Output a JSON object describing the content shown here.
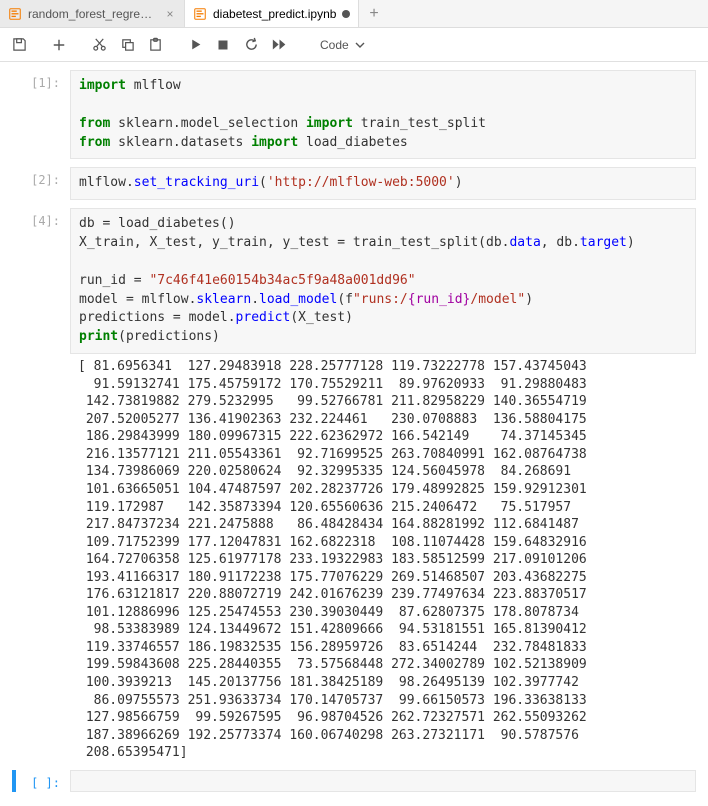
{
  "tabs": [
    {
      "label": "random_forest_regressor_s",
      "active": false,
      "dirty": false
    },
    {
      "label": "diabetest_predict.ipynb",
      "active": true,
      "dirty": true
    }
  ],
  "toolbar": {
    "celltype_label": "Code",
    "icons": {
      "save": "save-icon",
      "add": "plus-icon",
      "cut": "scissors-icon",
      "copy": "copy-icon",
      "paste": "clipboard-icon",
      "run": "play-icon",
      "stop": "stop-icon",
      "restart": "refresh-icon",
      "ff": "fast-forward-icon",
      "dropdown": "chevron-down-icon"
    }
  },
  "cells": [
    {
      "prompt": "[1]:",
      "code_html": "<span class=\"cm-k\">import</span> mlflow\n\n<span class=\"cm-k\">from</span> sklearn.model_selection <span class=\"cm-k\">import</span> train_test_split\n<span class=\"cm-k\">from</span> sklearn.datasets <span class=\"cm-k\">import</span> load_diabetes"
    },
    {
      "prompt": "[2]:",
      "code_html": "mlflow.<span class=\"cm-f\">set_tracking_uri</span>(<span class=\"cm-s\">'http://mlflow-web:5000'</span>)"
    },
    {
      "prompt": "[4]:",
      "code_html": "db = load_diabetes()\nX_train, X_test, y_train, y_test = train_test_split(db.<span class=\"cm-f\">data</span>, db.<span class=\"cm-f\">target</span>)\n\nrun_id = <span class=\"cm-s\">\"7c46f41e60154b34ac5f9a48a001dd96\"</span>\nmodel = mlflow.<span class=\"cm-f\">sklearn</span>.<span class=\"cm-f\">load_model</span>(f<span class=\"cm-rs\">\"runs:/</span><span class=\"cm-ri\">{run_id}</span><span class=\"cm-rs\">/model\"</span>)\npredictions = model.<span class=\"cm-f\">predict</span>(X_test)\n<span class=\"cm-k\">print</span>(predictions)",
      "output": "[ 81.6956341  127.29483918 228.25777128 119.73222778 157.43745043\n  91.59132741 175.45759172 170.75529211  89.97620933  91.29880483\n 142.73819882 279.5232995   99.52766781 211.82958229 140.36554719\n 207.52005277 136.41902363 232.224461   230.0708883  136.58804175\n 186.29843999 180.09967315 222.62362972 166.542149    74.37145345\n 216.13577121 211.05543361  92.71699525 263.70840991 162.08764738\n 134.73986069 220.02580624  92.32995335 124.56045978  84.268691\n 101.63665051 104.47487597 202.28237726 179.48992825 159.92912301\n 119.172987   142.35873394 120.65560636 215.2406472   75.517957\n 217.84737234 221.2475888   86.48428434 164.88281992 112.6841487\n 109.71752399 177.12047831 162.6822318  108.11074428 159.64832916\n 164.72706358 125.61977178 233.19322983 183.58512599 217.09101206\n 193.41166317 180.91172238 175.77076229 269.51468507 203.43682275\n 176.63121817 220.88072719 242.01676239 239.77497634 223.88370517\n 101.12886996 125.25474553 230.39030449  87.62807375 178.8078734\n  98.53383989 124.13449672 151.42809666  94.53181551 165.81390412\n 119.33746557 186.19832535 156.28959726  83.6514244  232.78481833\n 199.59843608 225.28440355  73.57568448 272.34002789 102.52138909\n 100.3939213  145.20137756 181.38425189  98.26495139 102.3977742\n  86.09755573 251.93633734 170.14705737  99.66150573 196.33638133\n 127.98566759  99.59267595  96.98704526 262.72327571 262.55093262\n 187.38966269 192.25773374 160.06740298 263.27321171  90.5787576\n 208.65395471]"
    },
    {
      "prompt": "[ ]:",
      "code_html": "",
      "new": true
    }
  ]
}
